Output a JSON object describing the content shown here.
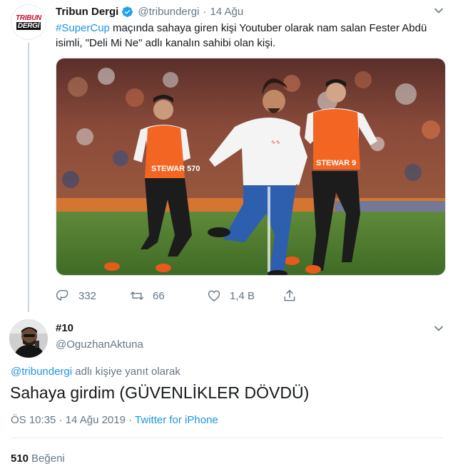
{
  "tweet1": {
    "avatar": {
      "line1": "TRIBUN",
      "line2": "DERGİ"
    },
    "author_name": "Tribun Dergi",
    "handle": "@tribundergi",
    "separator": "·",
    "date": "14 Ağu",
    "text": {
      "hashtag": "#SuperCup",
      "rest": " maçında sahaya giren kişi Youtuber olarak nam salan Fester Abdü isimli, \"Deli Mi Ne\" adlı kanalın sahibi olan kişi."
    },
    "photo": {
      "vest_left_text": "STEWAR 570",
      "vest_right_text": "STEWAR 9"
    },
    "actions": {
      "replies": "332",
      "retweets": "66",
      "likes": "1,4 B"
    },
    "icons": [
      "verified-badge-icon",
      "chevron-down-icon",
      "reply-icon",
      "retweet-icon",
      "like-icon",
      "share-icon"
    ],
    "colors": {
      "link": "#1b95e0",
      "muted": "#657786",
      "verified": "#1da1f2"
    }
  },
  "tweet2": {
    "author_name": "#10",
    "handle": "@OguzhanAktuna",
    "reply_mention": "@tribundergi",
    "reply_suffix": " adlı kişiye yanıt olarak",
    "text": "Sahaya girdim (GÜVENLİKLER DÖVDÜ)",
    "time_date": "ÖS 10:35 · 14 Ağu 2019 · ",
    "source": "Twitter for iPhone",
    "like_count": "510",
    "like_label": "Beğeni"
  }
}
